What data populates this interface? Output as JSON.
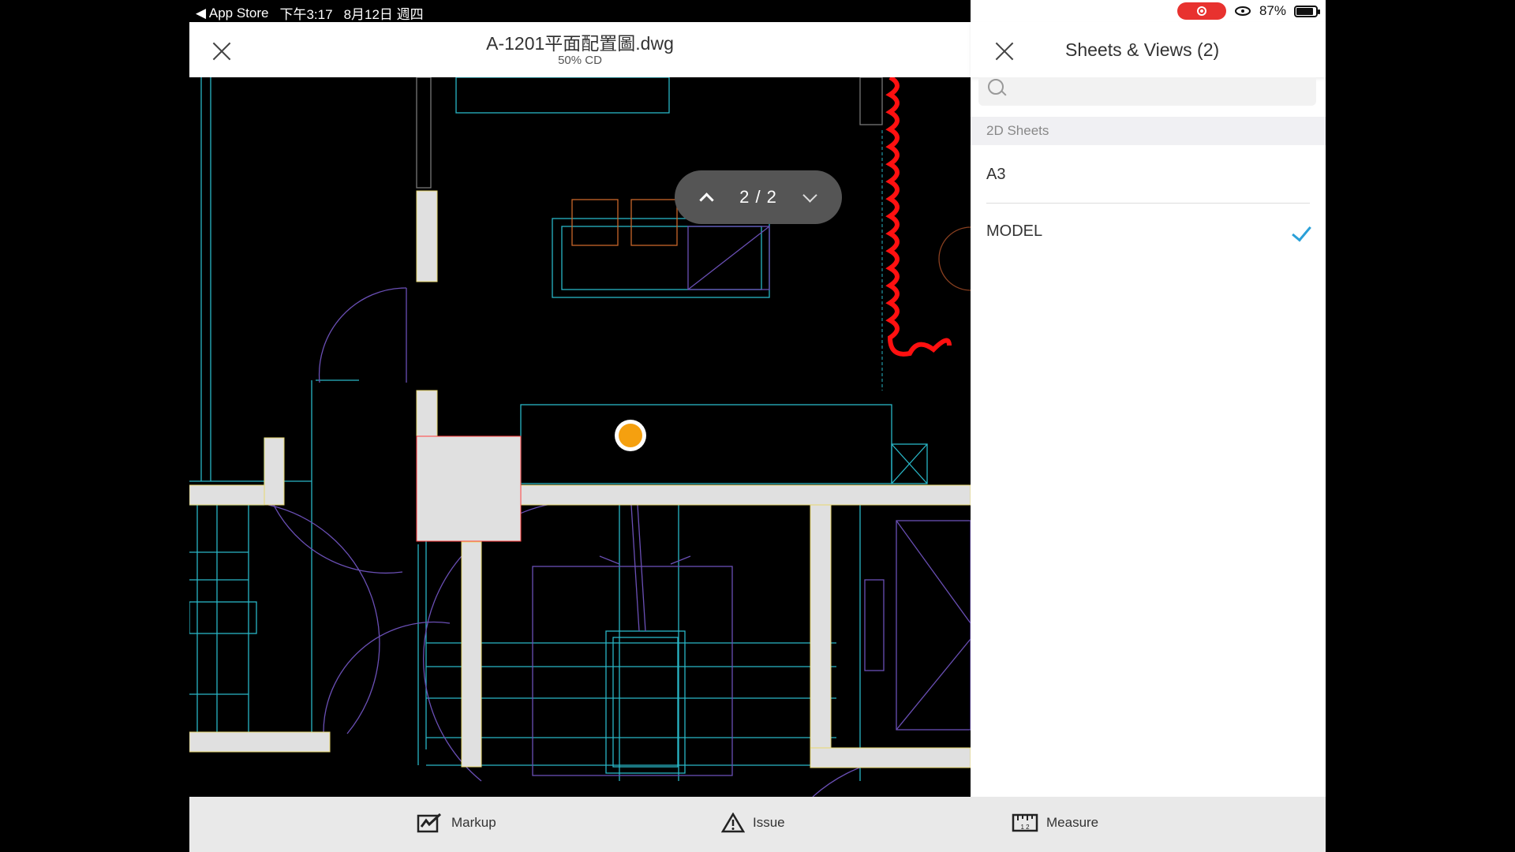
{
  "status_bar": {
    "back_app": "◀ App Store",
    "time": "下午3:17",
    "date": "8月12日 週四",
    "battery_percent": "87%",
    "battery_level": 0.87
  },
  "viewer": {
    "title": "A-1201平面配置圖.dwg",
    "subtitle": "50% CD",
    "pager": {
      "current": 2,
      "total": 2,
      "text": "2 / 2"
    }
  },
  "panel": {
    "title": "Sheets & Views (2)",
    "search_placeholder": "",
    "section_label": "2D Sheets",
    "items": [
      {
        "label": "A3",
        "selected": false
      },
      {
        "label": "MODEL",
        "selected": true
      }
    ]
  },
  "toolbar": {
    "markup_label": "Markup",
    "issue_label": "Issue",
    "measure_label": "Measure"
  },
  "colors": {
    "accent": "#2aa0d8",
    "record": "#e8322f",
    "marker": "#f5a00f",
    "revision_cloud": "#ff0000"
  }
}
